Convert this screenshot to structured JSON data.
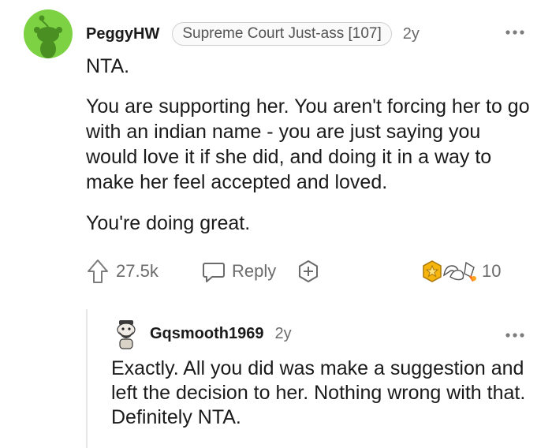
{
  "comment": {
    "username": "PeggyHW",
    "flair": "Supreme Court Just-ass [107]",
    "age": "2y",
    "more_icon": "more-icon",
    "paragraphs": [
      "NTA.",
      "You are supporting her. You aren't forcing her to go with an indian name - you are just saying you would love it if she did, and doing it in a way to make her feel accepted and loved.",
      "You're doing great."
    ],
    "actions": {
      "upvote_icon": "upvote-icon",
      "vote_count": "27.5k",
      "reply_icon": "reply-icon",
      "reply_label": "Reply",
      "award_icon": "add-award-icon",
      "awards_count": "10"
    }
  },
  "reply": {
    "username": "Gqsmooth1969",
    "age": "2y",
    "more_icon": "more-icon",
    "text": "Exactly. All you did was make a suggestion and left the decision to her. Nothing wrong with that. Definitely NTA."
  },
  "colors": {
    "avatar_green": "#7dd243",
    "muted_text": "#6b6b6b",
    "award_gold": "#f5b40e"
  }
}
